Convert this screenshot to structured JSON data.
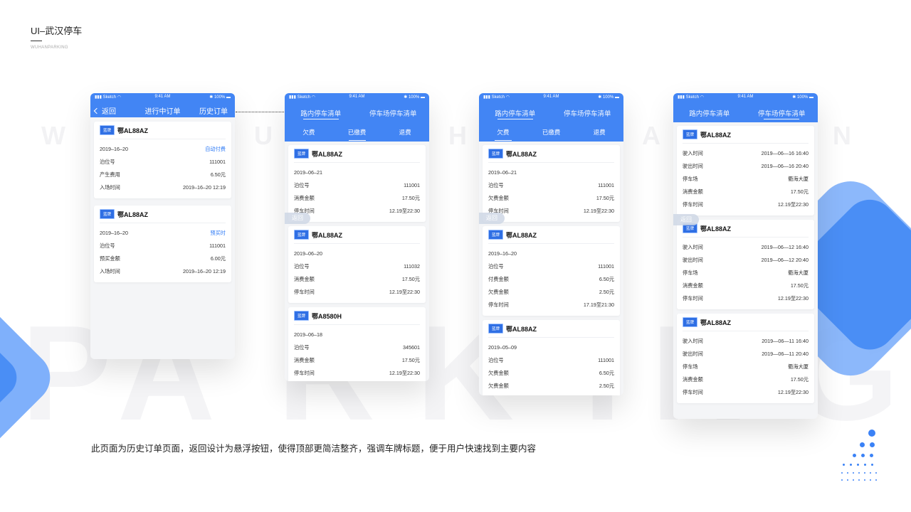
{
  "brand": {
    "title": "UI–武汉停车",
    "subtitle": "WUHANPARKING"
  },
  "bg_letters": [
    "W",
    "U",
    "H",
    "A",
    "N"
  ],
  "bg_word": [
    "P",
    "A",
    "R",
    "K",
    "I",
    "N",
    "G"
  ],
  "caption": "此页面为历史订单页面，返回设计为悬浮按钮，使得顶部更简洁整齐，强调车牌标题，便于用户快速找到主要内容",
  "status": {
    "carrier": "Sketch",
    "time": "9:41 AM",
    "battery": "100%"
  },
  "float_back_label": "返回",
  "colors": {
    "primary": "#4285f4",
    "badge": "#2f6fe4",
    "accent_text": "#2f7bf5"
  },
  "phone1": {
    "back_label": "返回",
    "title": "进行中订单",
    "right_label": "历史订单",
    "cards": [
      {
        "badge": "蓝牌",
        "plate": "鄂AL88AZ",
        "date": "2019–16–20",
        "status": "自动付费",
        "rows": [
          {
            "label": "泊位号",
            "value": "111001"
          },
          {
            "label": "产生费用",
            "value": "6.50元"
          },
          {
            "label": "入场时间",
            "value": "2019–16–20  12:19"
          }
        ]
      },
      {
        "badge": "蓝牌",
        "plate": "鄂AL88AZ",
        "date": "2019–16–20",
        "status": "预买时",
        "rows": [
          {
            "label": "泊位号",
            "value": "111001"
          },
          {
            "label": "预买金额",
            "value": "6.00元"
          },
          {
            "label": "入场时间",
            "value": "2019–16–20  12:19"
          }
        ]
      }
    ]
  },
  "phone2": {
    "tabs": [
      "路内停车清单",
      "停车场停车清单"
    ],
    "sub_tabs": [
      "欠费",
      "已缴费",
      "退费"
    ],
    "cards": [
      {
        "badge": "蓝牌",
        "plate": "鄂AL88AZ",
        "date": "2019–06–21",
        "rows": [
          {
            "label": "泊位号",
            "value": "111001"
          },
          {
            "label": "消费金额",
            "value": "17.50元"
          },
          {
            "label": "停车时间",
            "value": "12.19至22:30"
          }
        ]
      },
      {
        "badge": "蓝牌",
        "plate": "鄂AL88AZ",
        "date": "2019–06–20",
        "rows": [
          {
            "label": "泊位号",
            "value": "111032"
          },
          {
            "label": "消费金额",
            "value": "17.50元"
          },
          {
            "label": "停车时间",
            "value": "12.19至22:30"
          }
        ]
      },
      {
        "badge": "蓝牌",
        "plate": "鄂A8580H",
        "date": "2019–06–18",
        "rows": [
          {
            "label": "泊位号",
            "value": "345601"
          },
          {
            "label": "消费金额",
            "value": "17.50元"
          },
          {
            "label": "停车时间",
            "value": "12.19至22:30"
          }
        ]
      }
    ]
  },
  "phone3": {
    "tabs": [
      "路内停车清单",
      "停车场停车清单"
    ],
    "sub_tabs": [
      "欠费",
      "已缴费",
      "退费"
    ],
    "cards": [
      {
        "badge": "蓝牌",
        "plate": "鄂AL88AZ",
        "date": "2019–06–21",
        "rows": [
          {
            "label": "泊位号",
            "value": "111001"
          },
          {
            "label": "欠费金额",
            "value": "17.50元"
          },
          {
            "label": "停车时间",
            "value": "12.19至22:30"
          }
        ]
      },
      {
        "badge": "蓝牌",
        "plate": "鄂AL88AZ",
        "date": "2019–16–20",
        "rows": [
          {
            "label": "泊位号",
            "value": "111001"
          },
          {
            "label": "付费金额",
            "value": "6.50元"
          },
          {
            "label": "欠费金额",
            "value": "2.50元"
          },
          {
            "label": "停车时间",
            "value": "17.19至21:30"
          }
        ]
      },
      {
        "badge": "蓝牌",
        "plate": "鄂AL88AZ",
        "date": "2019–05–09",
        "rows": [
          {
            "label": "泊位号",
            "value": "111001"
          },
          {
            "label": "欠费金额",
            "value": "6.50元"
          },
          {
            "label": "欠费金额",
            "value": "2.50元"
          }
        ]
      }
    ]
  },
  "phone4": {
    "tabs": [
      "路内停车清单",
      "停车场停车清单"
    ],
    "cards": [
      {
        "badge": "蓝牌",
        "plate": "鄂AL88AZ",
        "rows": [
          {
            "label": "驶入时间",
            "value": "2019—06—16  16:40"
          },
          {
            "label": "驶出时间",
            "value": "2019—06—16  20:40"
          },
          {
            "label": "停车场",
            "value": "衢海大厦"
          },
          {
            "label": "消费金额",
            "value": "17.50元"
          },
          {
            "label": "停车时间",
            "value": "12.19至22:30"
          }
        ]
      },
      {
        "badge": "蓝牌",
        "plate": "鄂AL88AZ",
        "rows": [
          {
            "label": "驶入时间",
            "value": "2019—06—12  16:40"
          },
          {
            "label": "驶出时间",
            "value": "2019—06—12  20:40"
          },
          {
            "label": "停车场",
            "value": "衢海大厦"
          },
          {
            "label": "消费金额",
            "value": "17.50元"
          },
          {
            "label": "停车时间",
            "value": "12.19至22:30"
          }
        ]
      },
      {
        "badge": "蓝牌",
        "plate": "鄂AL88AZ",
        "rows": [
          {
            "label": "驶入时间",
            "value": "2019—06—11  16:40"
          },
          {
            "label": "驶出时间",
            "value": "2019—06—11  20:40"
          },
          {
            "label": "停车场",
            "value": "衢海大厦"
          },
          {
            "label": "消费金额",
            "value": "17.50元"
          },
          {
            "label": "停车时间",
            "value": "12.19至22:30"
          }
        ]
      }
    ]
  }
}
